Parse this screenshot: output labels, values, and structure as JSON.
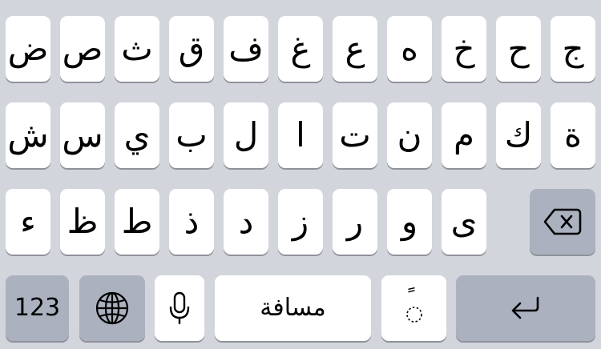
{
  "keyboard": {
    "row1": [
      "ض",
      "ص",
      "ث",
      "ق",
      "ف",
      "غ",
      "ع",
      "ه",
      "خ",
      "ح",
      "ج"
    ],
    "row2": [
      "ش",
      "س",
      "ي",
      "ب",
      "ل",
      "ا",
      "ت",
      "ن",
      "م",
      "ك",
      "ة"
    ],
    "row3": [
      "ء",
      "ظ",
      "ط",
      "ذ",
      "د",
      "ز",
      "ر",
      "و",
      "ى"
    ],
    "bottom": {
      "numbers_label": "123",
      "space_label": "مسافة",
      "diacritic_label": "ً"
    },
    "icons": {
      "backspace": "backspace-icon",
      "globe": "globe-icon",
      "microphone": "microphone-icon",
      "return": "return-arrow-icon"
    },
    "colors": {
      "background": "#d3d5dd",
      "key": "#ffffff",
      "function_key": "#abb1bf"
    }
  }
}
